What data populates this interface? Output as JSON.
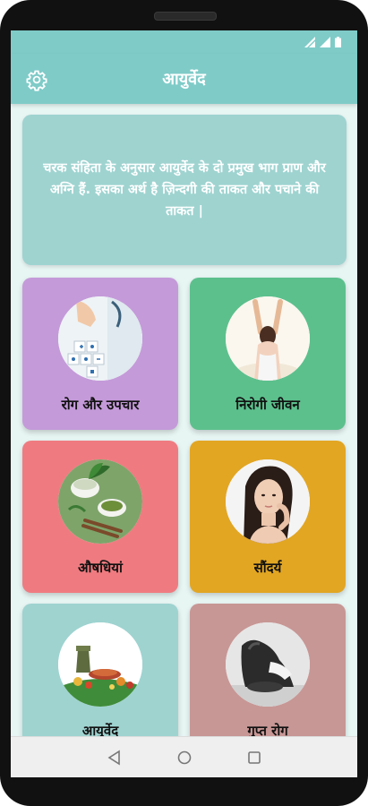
{
  "app": {
    "title": "आयुर्वेद"
  },
  "intro": {
    "text": "चरक संहिता के अनुसार आयुर्वेद के दो प्रमुख भाग प्राण और अग्नि हैं. इसका अर्थ है ज़िन्दगी की ताकत और पचाने की ताकत |"
  },
  "tiles": [
    {
      "label": "रोग और उपचार",
      "color": "#c49ad9"
    },
    {
      "label": "निरोगी जीवन",
      "color": "#5cc08d"
    },
    {
      "label": "औषधियां",
      "color": "#ef7b80"
    },
    {
      "label": "सौंदर्य",
      "color": "#e2a623"
    },
    {
      "label": "आयुर्वेद",
      "color": "#9ed3d0"
    },
    {
      "label": "गुप्त रोग",
      "color": "#c79795"
    }
  ],
  "colors": {
    "accent": "#7fcbc8",
    "background": "#e7f5f3"
  },
  "icons": {
    "settings": "gear-icon",
    "nav_back": "triangle-back-icon",
    "nav_home": "circle-home-icon",
    "nav_recents": "square-recents-icon"
  }
}
